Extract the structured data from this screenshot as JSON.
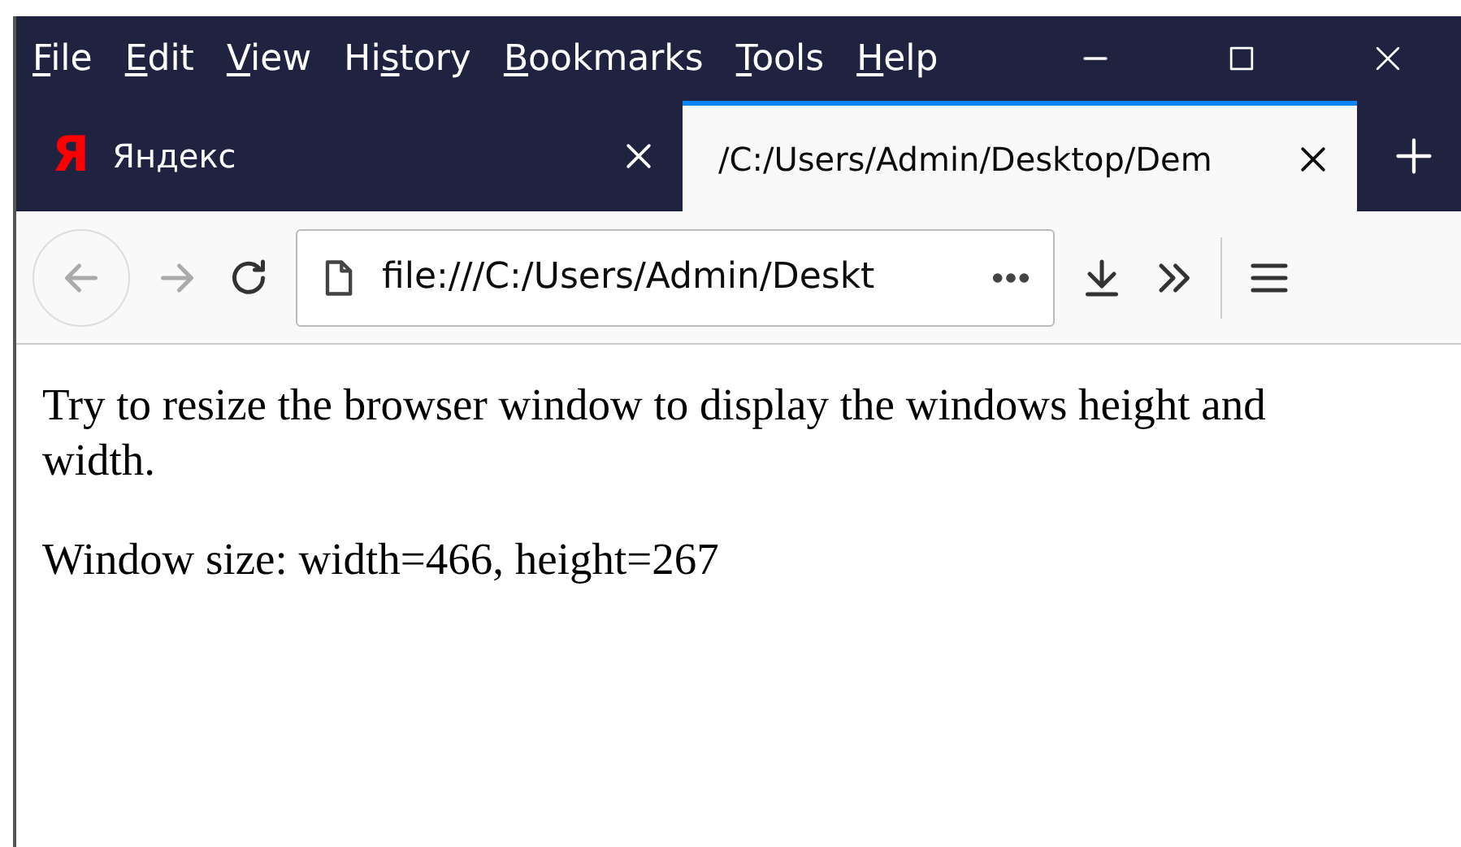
{
  "menu": [
    {
      "access_key": "F",
      "rest": "ile"
    },
    {
      "access_key": "E",
      "rest": "dit"
    },
    {
      "access_key": "V",
      "rest": "iew"
    },
    {
      "prefix": "Hi",
      "access_key": "s",
      "rest": "tory"
    },
    {
      "access_key": "B",
      "rest": "ookmarks"
    },
    {
      "access_key": "T",
      "rest": "ools"
    },
    {
      "access_key": "H",
      "rest": "elp"
    }
  ],
  "tabs": [
    {
      "favicon": "Я",
      "label": "Яндекс",
      "selected": false
    },
    {
      "label": "/C:/Users/Admin/Desktop/Dem",
      "selected": true
    }
  ],
  "toolbar": {
    "back_disabled": true,
    "forward_disabled": true,
    "url": "file:///C:/Users/Admin/Deskt"
  },
  "content": {
    "paragraphs": [
      "Try to resize the browser window to display the windows height and width.",
      "Window size: width=466, height=267"
    ]
  }
}
